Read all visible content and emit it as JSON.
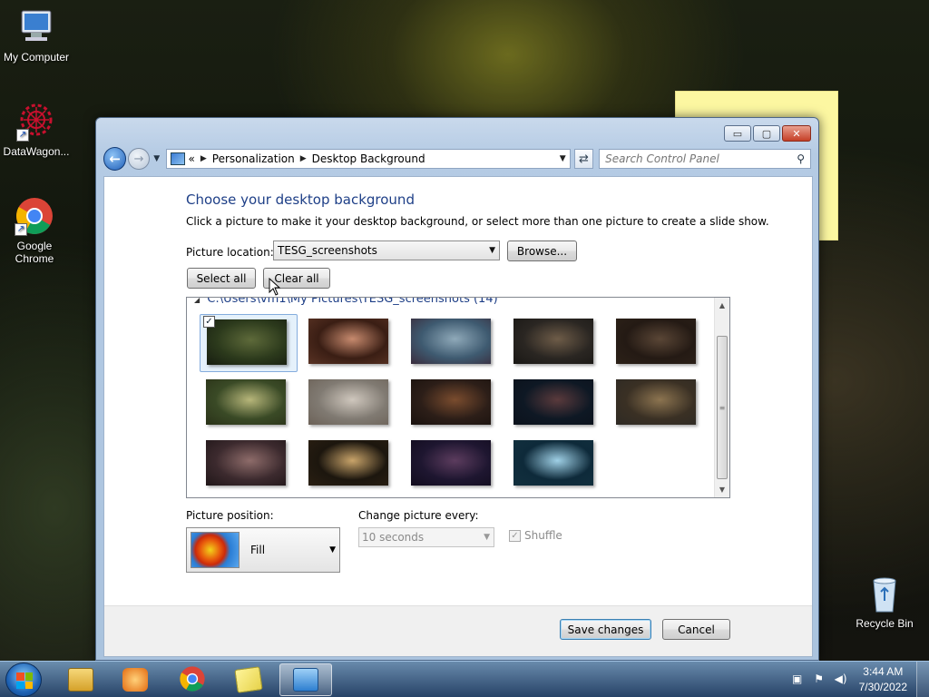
{
  "desktop": {
    "icons": [
      {
        "label": "My Computer",
        "icon": "computer-icon"
      },
      {
        "label": "DataWagon...",
        "icon": "datawagon-icon"
      },
      {
        "label": "Google Chrome",
        "icon": "chrome-icon"
      },
      {
        "label": "Recycle Bin",
        "icon": "recycle-bin-icon"
      }
    ]
  },
  "window": {
    "caption_buttons": {
      "minimize": "▭",
      "maximize": "▢",
      "close": "✕"
    },
    "nav": {
      "back": "←",
      "forward": "→",
      "breadcrumb_prefix": "«",
      "breadcrumb": [
        "Personalization",
        "Desktop Background"
      ],
      "search_placeholder": "Search Control Panel"
    },
    "heading": "Choose your desktop background",
    "subtext": "Click a picture to make it your desktop background, or select more than one picture to create a slide show.",
    "picture_location_label": "Picture location:",
    "picture_location_value": "TESG_screenshots",
    "browse_label": "Browse...",
    "select_all_label": "Select all",
    "clear_all_label": "Clear all",
    "group_header": "C:\\Users\\vm1\\My Pictures\\TESG_screenshots (14)",
    "thumbnails": [
      {
        "selected": true,
        "colors": [
          "#2c3a1c",
          "#5e6a3a",
          "#161c10"
        ]
      },
      {
        "selected": false,
        "colors": [
          "#3a1e14",
          "#c78a6e",
          "#5a3324"
        ]
      },
      {
        "selected": false,
        "colors": [
          "#3e5a70",
          "#8fa9b9",
          "#3a2c3c"
        ]
      },
      {
        "selected": false,
        "colors": [
          "#2a2622",
          "#6e5c48",
          "#1a1815"
        ]
      },
      {
        "selected": false,
        "colors": [
          "#241a14",
          "#5a4636",
          "#2c2118"
        ]
      },
      {
        "selected": false,
        "colors": [
          "#3a4a26",
          "#b7b67a",
          "#2a3218"
        ]
      },
      {
        "selected": false,
        "colors": [
          "#807a72",
          "#cfc7bd",
          "#6c6258"
        ]
      },
      {
        "selected": false,
        "colors": [
          "#2c1e18",
          "#7a4c2e",
          "#1a120e"
        ]
      },
      {
        "selected": false,
        "colors": [
          "#0e1824",
          "#5a3a3c",
          "#0c121c"
        ]
      },
      {
        "selected": false,
        "colors": [
          "#3a3024",
          "#8c7450",
          "#2e2a24"
        ]
      },
      {
        "selected": false,
        "colors": [
          "#3c2a2e",
          "#8e6c6a",
          "#201618"
        ]
      },
      {
        "selected": false,
        "colors": [
          "#1c160e",
          "#c9a46a",
          "#2a1f12"
        ]
      },
      {
        "selected": false,
        "colors": [
          "#1e1630",
          "#5c3c5e",
          "#120c1e"
        ]
      },
      {
        "selected": false,
        "colors": [
          "#0e2a3a",
          "#9fd0e6",
          "#12303e"
        ]
      }
    ],
    "picture_position_label": "Picture position:",
    "picture_position_value": "Fill",
    "change_every_label": "Change picture every:",
    "change_every_value": "10 seconds",
    "shuffle_label": "Shuffle",
    "save_label": "Save changes",
    "cancel_label": "Cancel"
  },
  "taskbar": {
    "items": [
      {
        "icon": "explorer-icon",
        "active": false
      },
      {
        "icon": "media-player-icon",
        "active": false
      },
      {
        "icon": "chrome-icon",
        "active": false
      },
      {
        "icon": "sticky-notes-icon",
        "active": false
      },
      {
        "icon": "control-panel-icon",
        "active": true
      }
    ],
    "clock_time": "3:44 AM",
    "clock_date": "7/30/2022"
  }
}
